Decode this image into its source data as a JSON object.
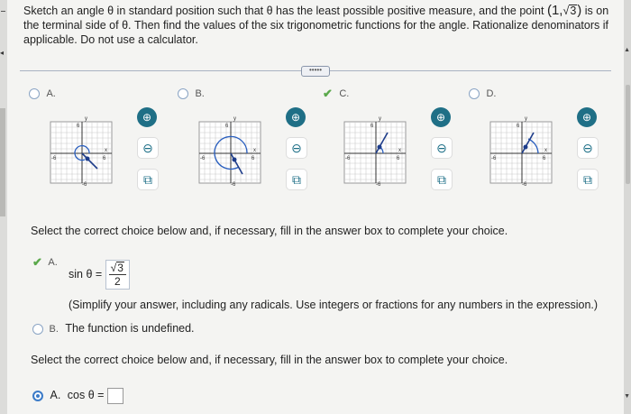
{
  "question": {
    "line1_pre": "Sketch an angle θ in standard position such that θ has the least possible positive measure, and the point",
    "point_open": "(1,",
    "point_root": "3",
    "point_close": ")",
    "line1_post": "is on",
    "line2": "the terminal side of θ. Then find the values of the six trigonometric functions for the angle. Rationalize denominators if",
    "line3": "applicable. Do not use a calculator."
  },
  "more_button": "•••••",
  "choices": [
    {
      "label": "A.",
      "selected": false,
      "correct": false
    },
    {
      "label": "B.",
      "selected": false,
      "correct": false
    },
    {
      "label": "C.",
      "selected": true,
      "correct": true
    },
    {
      "label": "D.",
      "selected": false,
      "correct": false
    }
  ],
  "graph": {
    "axis_x": "x",
    "axis_y": "y",
    "tick_top": "6",
    "tick_bottom": "-6",
    "tick_left": "-6",
    "tick_right": "6"
  },
  "tools": {
    "zoom_in": "zoom-in-icon",
    "zoom_out": "zoom-out-icon",
    "popout": "popout-icon"
  },
  "part1": {
    "instruction": "Select the correct choice below and, if necessary, fill in the answer box to complete your choice.",
    "a_label": "A.",
    "a_func": "sin θ =",
    "a_num_root": "3",
    "a_den": "2",
    "a_note": "(Simplify your answer, including any radicals. Use integers or fractions for any numbers in the expression.)",
    "b_label": "B.",
    "b_text": "The function is undefined."
  },
  "part2": {
    "instruction": "Select the correct choice below and, if necessary, fill in the answer box to complete your choice.",
    "a_label": "A.",
    "a_func": "cos θ ="
  },
  "colors": {
    "accent": "#3d7cc8",
    "correct": "#5aa84b",
    "tool": "#1f6f86"
  }
}
